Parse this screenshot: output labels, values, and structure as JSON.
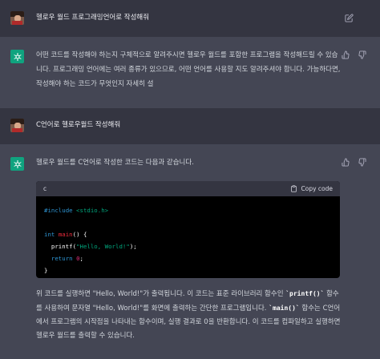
{
  "messages": [
    {
      "role": "user",
      "text": "헬로우 월드 프로그래밍언어로 작성해줘"
    },
    {
      "role": "assistant",
      "text": "어떤 코드를 작성해야 하는지 구체적으로 알려주시면 헬로우 월드를 포함한 프로그램을 작성해드릴 수 있습니다. 프로그래밍 언어에는 여러 종류가 있으므로, 어떤 언어를 사용할 지도 알려주셔야 합니다. 가능하다면, 작성해야 하는 코드가 무엇인지 자세히 설"
    },
    {
      "role": "user",
      "text": "C언어로 헬로우월드 작성해줘"
    },
    {
      "role": "assistant",
      "intro": "헬로우 월드를 C언어로 작성한 코드는 다음과 같습니다.",
      "code": {
        "language": "c",
        "copy_label": "Copy code",
        "lines": {
          "l1_a": "#include ",
          "l1_b": "<stdio.h>",
          "l2_a": "int ",
          "l2_b": "main",
          "l2_c": "() {",
          "l3_a": "  ",
          "l3_b": "printf",
          "l3_c": "(",
          "l3_d": "\"Hello, World!\"",
          "l3_e": ");",
          "l4_a": "  ",
          "l4_b": "return ",
          "l4_c": "0",
          "l4_d": ";",
          "l5": "}"
        }
      },
      "after_1": "위 코드를 실행하면 \"Hello, World!\"가 출력됩니다. 이 코드는 표준 라이브러리 함수인",
      "after_code_1": "`printf()`",
      "after_2": " 함수를 사용하여 문자열 \"Hello, World!\"를 화면에 출력하는 간단한 프로그램입니다. ",
      "after_code_2": "`main()`",
      "after_3": " 함수는 C언어에서 프로그램의 시작점을 나타내는 함수이며, 실행 결과로 0을 반환합니다. 이 코드를 컴파일하고 실행하면 헬로우 월드를 출력할 수 있습니다."
    }
  ],
  "icons": {
    "edit": "pencil-square-icon",
    "thumbs_up": "thumbs-up-icon",
    "thumbs_down": "thumbs-down-icon",
    "copy": "clipboard-icon",
    "bot_avatar": "openai-logo-icon"
  },
  "colors": {
    "user_bg": "#343541",
    "bot_bg": "#444654",
    "accent": "#10a37f"
  }
}
